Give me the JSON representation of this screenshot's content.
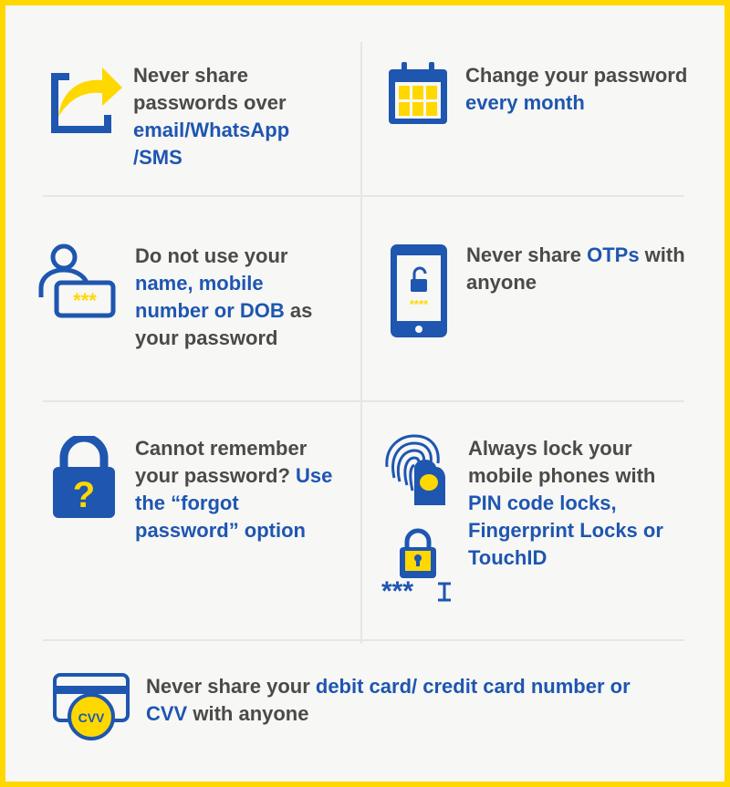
{
  "colors": {
    "border": "#ffd800",
    "background": "#f7f7f5",
    "text": "#4a4a4a",
    "accent": "#1e56b0",
    "highlight": "#ffd800"
  },
  "tips": [
    {
      "icon": "share-arrow-icon",
      "lines": [
        [
          {
            "t": "Never share",
            "hl": false
          }
        ],
        [
          {
            "t": "passwords over",
            "hl": false
          }
        ],
        [
          {
            "t": "email/WhatsApp",
            "hl": true
          }
        ],
        [
          {
            "t": "/SMS",
            "hl": true
          }
        ]
      ]
    },
    {
      "icon": "calendar-icon",
      "lines": [
        [
          {
            "t": "Change your password",
            "hl": false
          }
        ],
        [
          {
            "t": "every month",
            "hl": true
          }
        ]
      ]
    },
    {
      "icon": "user-password-icon",
      "lines": [
        [
          {
            "t": "Do not use your",
            "hl": false
          }
        ],
        [
          {
            "t": "name, mobile",
            "hl": true
          }
        ],
        [
          {
            "t": "number or DOB",
            "hl": true
          },
          {
            "t": " as",
            "hl": false
          }
        ],
        [
          {
            "t": "your password",
            "hl": false
          }
        ]
      ]
    },
    {
      "icon": "phone-otp-icon",
      "lines": [
        [
          {
            "t": "Never share ",
            "hl": false
          },
          {
            "t": "OTPs",
            "hl": true
          },
          {
            "t": " with",
            "hl": false
          }
        ],
        [
          {
            "t": "anyone",
            "hl": false
          }
        ]
      ]
    },
    {
      "icon": "lock-question-icon",
      "lines": [
        [
          {
            "t": "Cannot remember",
            "hl": false
          }
        ],
        [
          {
            "t": "your password? ",
            "hl": false
          },
          {
            "t": "Use",
            "hl": true
          }
        ],
        [
          {
            "t": "the “forgot",
            "hl": true
          }
        ],
        [
          {
            "t": "password” option",
            "hl": true
          }
        ]
      ]
    },
    {
      "icon": "fingerprint-lock-icon",
      "lines": [
        [
          {
            "t": "Always lock your",
            "hl": false
          }
        ],
        [
          {
            "t": "mobile phones with",
            "hl": false
          }
        ],
        [
          {
            "t": "PIN code locks,",
            "hl": true
          }
        ],
        [
          {
            "t": "Fingerprint Locks or",
            "hl": true
          }
        ],
        [
          {
            "t": "TouchID",
            "hl": true
          }
        ]
      ]
    },
    {
      "icon": "cvv-card-icon",
      "lines": [
        [
          {
            "t": "Never share your ",
            "hl": false
          },
          {
            "t": "debit card/ credit card number or",
            "hl": true
          }
        ],
        [
          {
            "t": "CVV",
            "hl": true
          },
          {
            "t": " with anyone",
            "hl": false
          }
        ]
      ]
    }
  ],
  "icon_text": {
    "password_mask": "***",
    "pin_mask": "****",
    "cvv": "CVV"
  }
}
